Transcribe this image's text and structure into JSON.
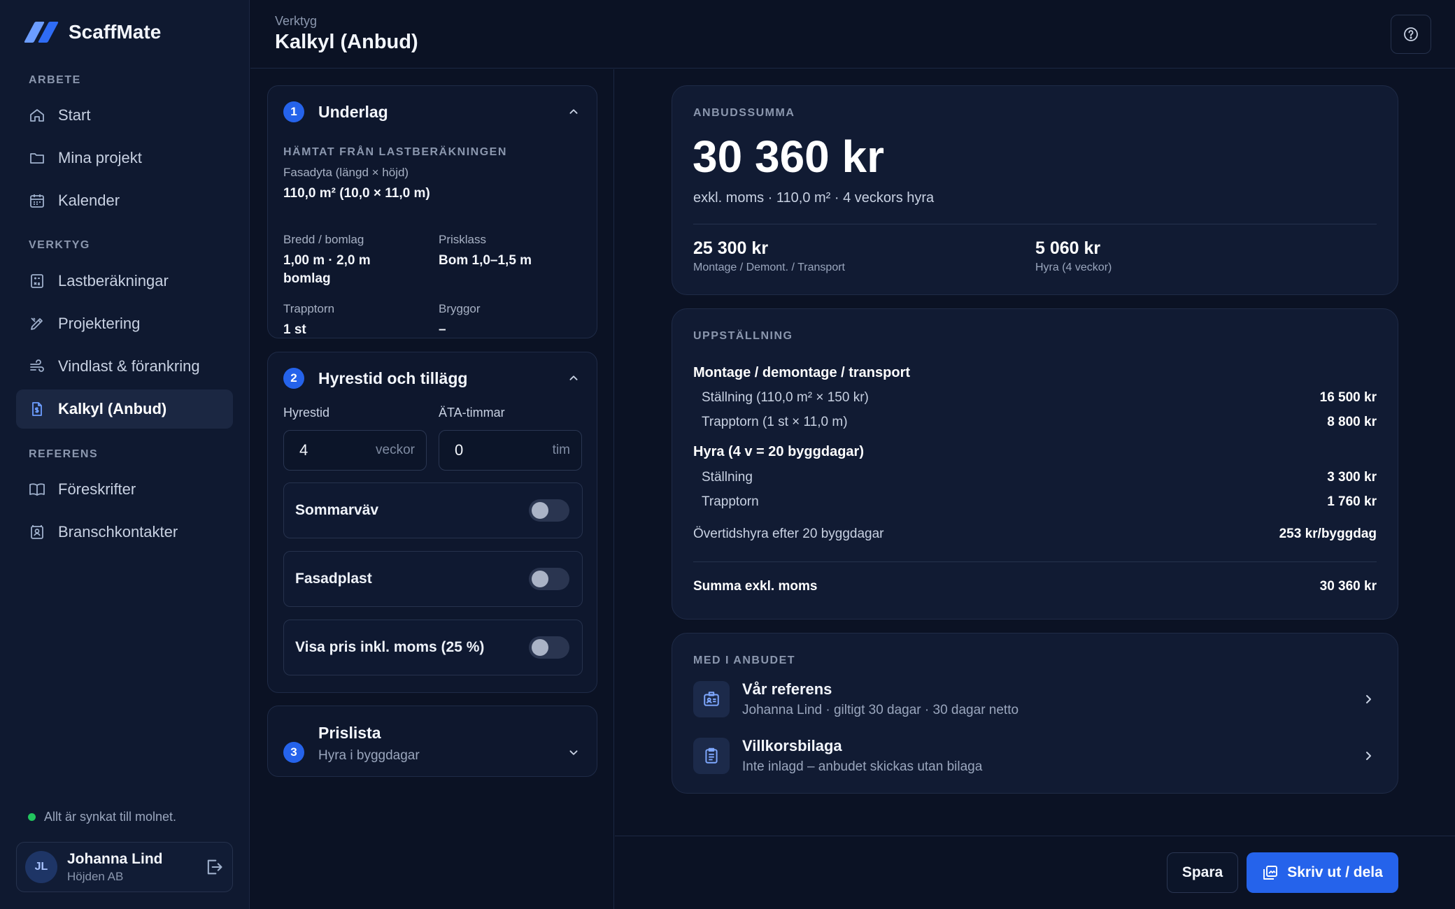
{
  "app": {
    "name": "ScaffMate"
  },
  "sidebar": {
    "sections": [
      {
        "title": "ARBETE",
        "items": [
          {
            "label": "Start",
            "icon": "home-icon"
          },
          {
            "label": "Mina projekt",
            "icon": "folder-icon"
          },
          {
            "label": "Kalender",
            "icon": "calendar-icon"
          }
        ]
      },
      {
        "title": "VERKTYG",
        "items": [
          {
            "label": "Lastberäkningar",
            "icon": "calculator-icon"
          },
          {
            "label": "Projektering",
            "icon": "drafting-icon"
          },
          {
            "label": "Vindlast & förankring",
            "icon": "wind-icon"
          },
          {
            "label": "Kalkyl (Anbud)",
            "icon": "document-dollar-icon",
            "active": true
          }
        ]
      },
      {
        "title": "REFERENS",
        "items": [
          {
            "label": "Föreskrifter",
            "icon": "book-icon"
          },
          {
            "label": "Branschkontakter",
            "icon": "contacts-icon"
          }
        ]
      }
    ],
    "sync_status": "Allt är synkat till molnet.",
    "user": {
      "initials": "JL",
      "name": "Johanna Lind",
      "company": "Höjden AB"
    }
  },
  "header": {
    "breadcrumb": "Verktyg",
    "title": "Kalkyl (Anbud)"
  },
  "underlag": {
    "number": "1",
    "title": "Underlag",
    "subtitle": "HÄMTAT FRÅN LASTBERÄKNINGEN",
    "fasadyta_label": "Fasadyta (längd × höjd)",
    "fasadyta_value": "110,0 m² (10,0 × 11,0 m)",
    "bredd_label": "Bredd / bomlag",
    "bredd_value_line1": "1,00 m · 2,0 m",
    "bredd_value_line2": "bomlag",
    "prisklass_label": "Prisklass",
    "prisklass_value": "Bom 1,0–1,5 m",
    "trapptorn_label": "Trapptorn",
    "trapptorn_value": "1 st",
    "bryggor_label": "Bryggor",
    "bryggor_value": "–"
  },
  "hyrestid": {
    "number": "2",
    "title": "Hyrestid och tillägg",
    "hyrestid_label": "Hyrestid",
    "hyrestid_value": "4",
    "hyrestid_unit": "veckor",
    "ata_label": "ÄTA-timmar",
    "ata_value": "0",
    "ata_unit": "tim",
    "toggles": [
      {
        "label": "Sommarväv",
        "on": false
      },
      {
        "label": "Fasadplast",
        "on": false
      },
      {
        "label": "Visa pris inkl. moms (25 %)",
        "on": false
      }
    ]
  },
  "prislista": {
    "number": "3",
    "title": "Prislista",
    "subtitle": "Hyra i byggdagar"
  },
  "summary": {
    "eyebrow": "ANBUDSSUMMA",
    "total": "30 360 kr",
    "detail": "exkl. moms · 110,0 m² · 4 veckors hyra",
    "montage_value": "25 300 kr",
    "montage_label": "Montage / Demont. / Transport",
    "hyra_value": "5 060 kr",
    "hyra_label": "Hyra (4 veckor)"
  },
  "breakdown": {
    "eyebrow": "UPPSTÄLLNING",
    "group1": "Montage / demontage / transport",
    "row1_label": "Ställning (110,0 m² × 150 kr)",
    "row1_value": "16 500 kr",
    "row2_label": "Trapptorn (1 st × 11,0 m)",
    "row2_value": "8 800 kr",
    "group2": "Hyra (4 v = 20 byggdagar)",
    "row3_label": "Ställning",
    "row3_value": "3 300 kr",
    "row4_label": "Trapptorn",
    "row4_value": "1 760 kr",
    "overtime_label": "Övertidshyra efter 20 byggdagar",
    "overtime_value": "253 kr/byggdag",
    "sum_label": "Summa exkl. moms",
    "sum_value": "30 360 kr"
  },
  "attachments": {
    "eyebrow": "MED I ANBUDET",
    "ref_title": "Vår referens",
    "ref_sub": "Johanna Lind · giltigt 30 dagar · 30 dagar netto",
    "terms_title": "Villkorsbilaga",
    "terms_sub": "Inte inlagd – anbudet skickas utan bilaga"
  },
  "footer": {
    "save_label": "Spara",
    "print_label": "Skriv ut / dela"
  },
  "colors": {
    "accent": "#2563eb",
    "success": "#22c55e",
    "background": "#0b1224"
  }
}
